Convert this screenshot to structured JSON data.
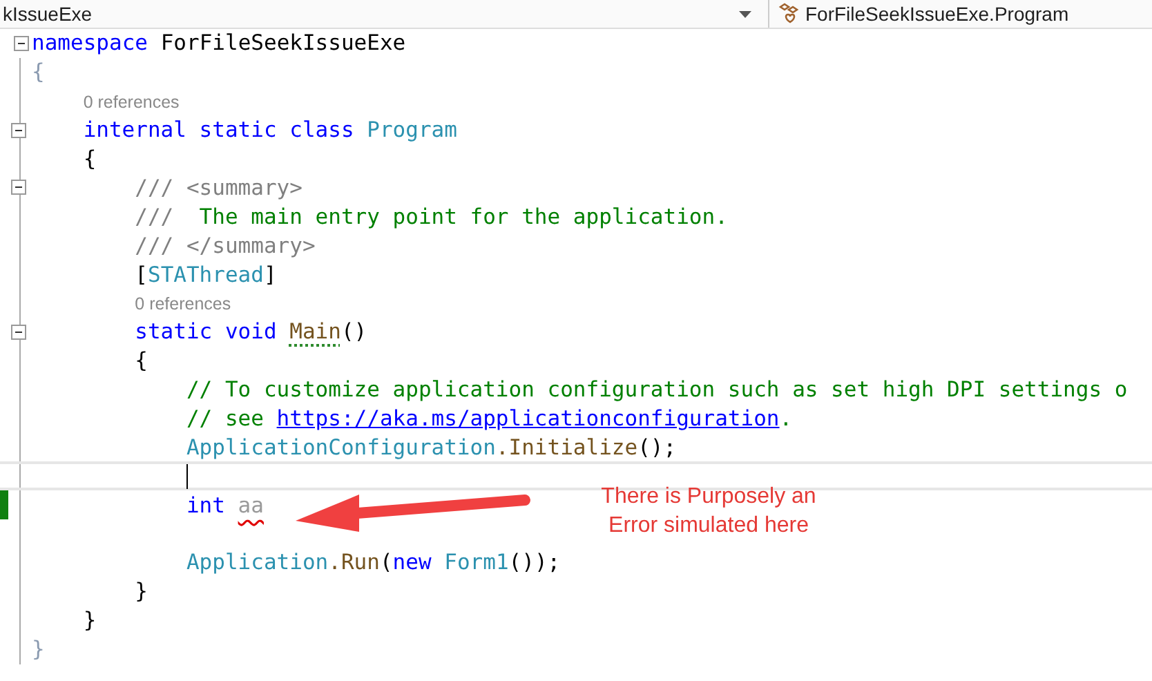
{
  "navigation_bar": {
    "type_dropdown": "kIssueExe",
    "member_dropdown": "ForFileSeekIssueExe.Program"
  },
  "editor": {
    "lines": [
      {
        "collapsible": true,
        "changed": false,
        "current": false,
        "tokens": [
          {
            "text": "namespace ",
            "kind": "keyword"
          },
          {
            "text": "ForFileSeekIssueExe",
            "kind": "plain"
          }
        ]
      },
      {
        "collapsible": false,
        "changed": false,
        "current": false,
        "tokens": [
          {
            "text": "{",
            "kind": "faded"
          }
        ],
        "children": [
          {
            "collapsible": false,
            "changed": false,
            "current": false,
            "tokens": [
              {
                "text": "0 references",
                "kind": "codelens"
              }
            ]
          },
          {
            "collapsible": true,
            "changed": false,
            "current": false,
            "tokens": [
              {
                "text": "internal static class ",
                "kind": "keyword"
              },
              {
                "text": "Program",
                "kind": "type"
              }
            ]
          },
          {
            "collapsible": false,
            "changed": false,
            "current": false,
            "tokens": [
              {
                "text": "{",
                "kind": "plain"
              }
            ],
            "children": [
              {
                "collapsible": true,
                "changed": false,
                "current": false,
                "tokens": [
                  {
                    "text": "/// <summary>",
                    "kind": "doc"
                  }
                ]
              },
              {
                "collapsible": false,
                "changed": false,
                "current": false,
                "tokens": [
                  {
                    "text": "/// ",
                    "kind": "doc"
                  },
                  {
                    "text": " The main entry point for the application.",
                    "kind": "comment"
                  }
                ]
              },
              {
                "collapsible": false,
                "changed": false,
                "current": false,
                "tokens": [
                  {
                    "text": "/// </summary>",
                    "kind": "doc"
                  }
                ]
              },
              {
                "collapsible": false,
                "changed": false,
                "current": false,
                "tokens": [
                  {
                    "text": "[",
                    "kind": "plain"
                  },
                  {
                    "text": "STAThread",
                    "kind": "type"
                  },
                  {
                    "text": "]",
                    "kind": "plain"
                  }
                ]
              },
              {
                "collapsible": false,
                "changed": false,
                "current": false,
                "tokens": [
                  {
                    "text": "0 references",
                    "kind": "codelens"
                  }
                ]
              },
              {
                "collapsible": true,
                "changed": false,
                "current": false,
                "tokens": [
                  {
                    "text": "static void ",
                    "kind": "keyword"
                  },
                  {
                    "text": "Main",
                    "kind": "method",
                    "suggestion_dots": true
                  },
                  {
                    "text": "()",
                    "kind": "plain"
                  }
                ]
              },
              {
                "collapsible": false,
                "changed": false,
                "current": false,
                "tokens": [
                  {
                    "text": "{",
                    "kind": "plain"
                  }
                ],
                "children": [
                  {
                    "collapsible": false,
                    "changed": false,
                    "current": false,
                    "tokens": [
                      {
                        "text": "// To customize application configuration such as set high DPI settings o",
                        "kind": "comment"
                      }
                    ]
                  },
                  {
                    "collapsible": false,
                    "changed": false,
                    "current": false,
                    "tokens": [
                      {
                        "text": "// see ",
                        "kind": "comment"
                      },
                      {
                        "text": "https://aka.ms/applicationconfiguration",
                        "kind": "link"
                      },
                      {
                        "text": ".",
                        "kind": "comment"
                      }
                    ]
                  },
                  {
                    "collapsible": false,
                    "changed": false,
                    "current": false,
                    "tokens": [
                      {
                        "text": "ApplicationConfiguration",
                        "kind": "type"
                      },
                      {
                        "text": ".Initialize",
                        "kind": "method"
                      },
                      {
                        "text": "();",
                        "kind": "plain"
                      }
                    ]
                  },
                  {
                    "collapsible": false,
                    "changed": false,
                    "current": true
                  },
                  {
                    "collapsible": false,
                    "changed": true,
                    "current": false,
                    "tokens": [
                      {
                        "text": "int ",
                        "kind": "keyword"
                      },
                      {
                        "text": "aa",
                        "kind": "unused",
                        "error_squiggle": true
                      }
                    ]
                  },
                  {
                    "collapsible": false,
                    "changed": false,
                    "current": false
                  },
                  {
                    "collapsible": false,
                    "changed": false,
                    "current": false,
                    "tokens": [
                      {
                        "text": "Application",
                        "kind": "type"
                      },
                      {
                        "text": ".Run",
                        "kind": "method"
                      },
                      {
                        "text": "(",
                        "kind": "plain"
                      },
                      {
                        "text": "new ",
                        "kind": "keyword"
                      },
                      {
                        "text": "Form1",
                        "kind": "type"
                      },
                      {
                        "text": "());",
                        "kind": "plain"
                      }
                    ]
                  }
                ]
              },
              {
                "collapsible": false,
                "changed": false,
                "current": false,
                "tokens": [
                  {
                    "text": "}",
                    "kind": "plain"
                  }
                ]
              }
            ]
          },
          {
            "collapsible": false,
            "changed": false,
            "current": false,
            "tokens": [
              {
                "text": "}",
                "kind": "plain"
              }
            ]
          }
        ]
      },
      {
        "collapsible": false,
        "changed": false,
        "current": false,
        "tokens": [
          {
            "text": "}",
            "kind": "faded"
          }
        ]
      }
    ]
  },
  "annotation": {
    "text": "There is Purposely an\nError simulated here"
  }
}
